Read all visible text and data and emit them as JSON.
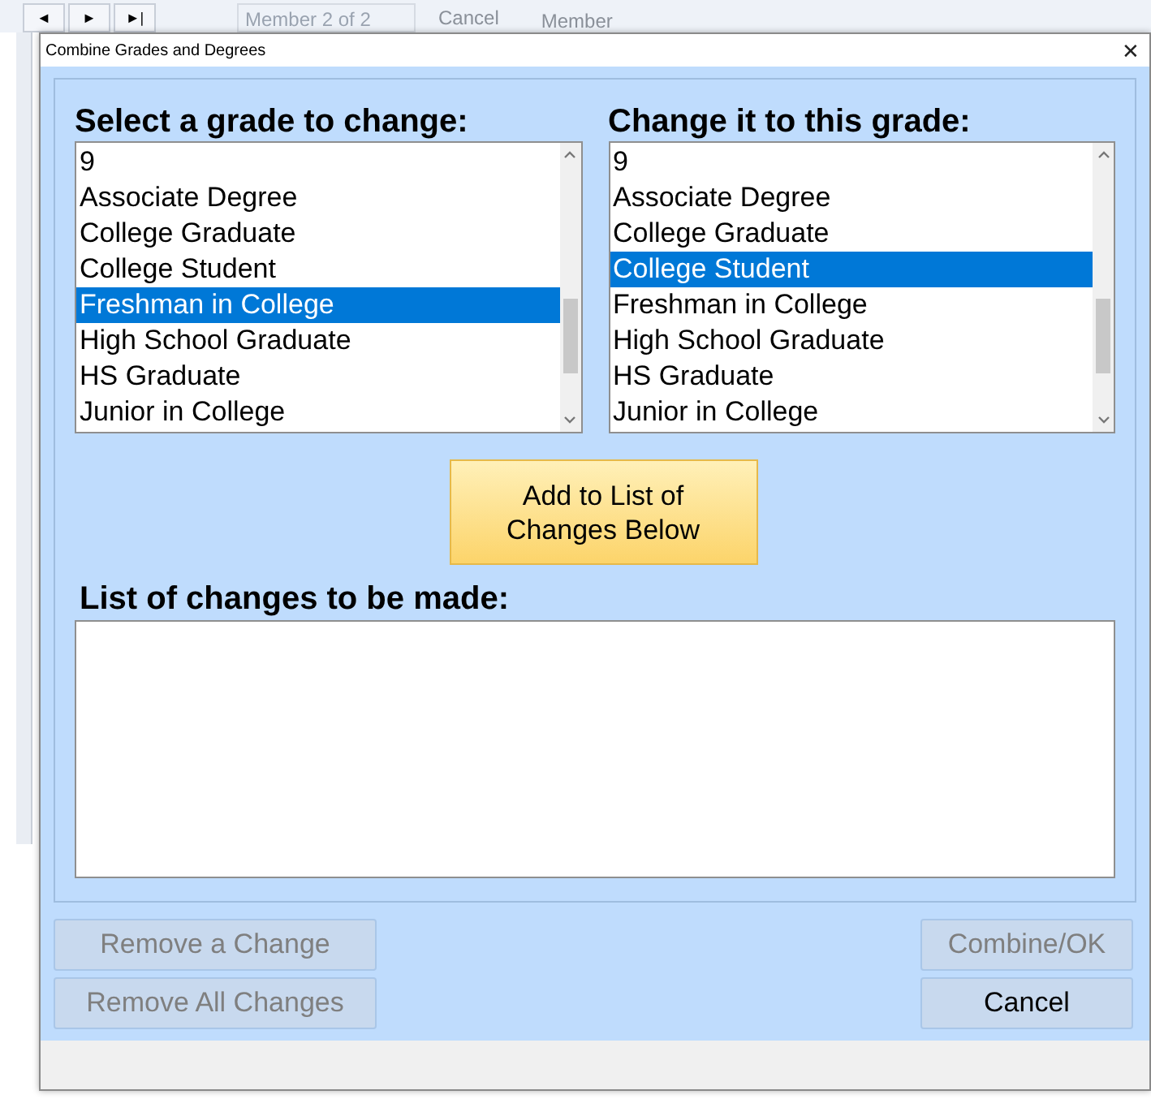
{
  "background_toolbar": {
    "nav_buttons": [
      "◄",
      "►",
      "►|"
    ],
    "record_selector": "Member 2 of 2",
    "cancel_button": "Cancel",
    "delete_button": "Member"
  },
  "window": {
    "title": "Combine Grades and Degrees",
    "close": "✕"
  },
  "source_list": {
    "label": "Select a grade to change:",
    "items": [
      {
        "text": "9",
        "selected": false
      },
      {
        "text": "Associate Degree",
        "selected": false
      },
      {
        "text": "College Graduate",
        "selected": false
      },
      {
        "text": "College Student",
        "selected": false
      },
      {
        "text": "Freshman in College",
        "selected": true
      },
      {
        "text": "High School Graduate",
        "selected": false
      },
      {
        "text": "HS Graduate",
        "selected": false
      },
      {
        "text": "Junior in College",
        "selected": false
      }
    ]
  },
  "target_list": {
    "label": "Change it to this grade:",
    "items": [
      {
        "text": "9",
        "selected": false
      },
      {
        "text": "Associate Degree",
        "selected": false
      },
      {
        "text": "College Graduate",
        "selected": false
      },
      {
        "text": "College Student",
        "selected": true
      },
      {
        "text": "Freshman in College",
        "selected": false
      },
      {
        "text": "High School Graduate",
        "selected": false
      },
      {
        "text": "HS Graduate",
        "selected": false
      },
      {
        "text": "Junior in College",
        "selected": false
      }
    ]
  },
  "add_button": "Add to List of Changes Below",
  "changes": {
    "label": "List of changes to be made:"
  },
  "left_buttons": [
    {
      "label": "Remove a Change",
      "disabled": true
    },
    {
      "label": "Remove All Changes",
      "disabled": true
    }
  ],
  "right_buttons": [
    {
      "label": "Combine/OK",
      "disabled": true
    },
    {
      "label": "Cancel",
      "disabled": false
    }
  ]
}
